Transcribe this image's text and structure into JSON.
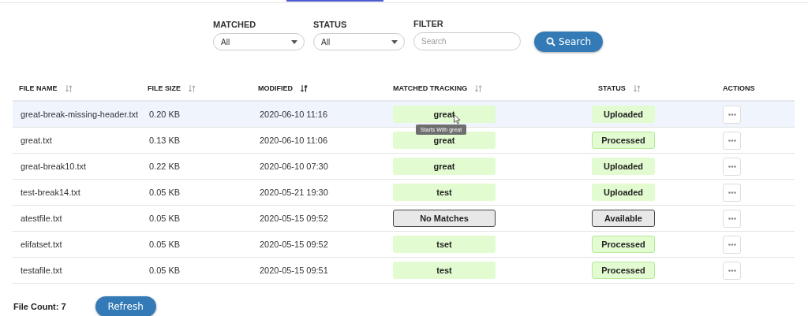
{
  "filters": [
    {
      "kind": "select",
      "label": "MATCHED",
      "value": "All"
    },
    {
      "kind": "select",
      "label": "STATUS",
      "value": "All"
    },
    {
      "kind": "text",
      "label": "FILTER",
      "placeholder": "Search"
    }
  ],
  "search_button": "Search",
  "table": {
    "columns": [
      {
        "label": "FILE NAME",
        "sortable": true,
        "sorted": false
      },
      {
        "label": "FILE SIZE",
        "sortable": true,
        "sorted": false
      },
      {
        "label": "MODIFIED",
        "sortable": true,
        "sorted": true
      },
      {
        "label": "MATCHED TRACKING",
        "sortable": true,
        "sorted": false
      },
      {
        "label": "STATUS",
        "sortable": true,
        "sorted": false
      },
      {
        "label": "ACTIONS"
      }
    ],
    "rows": [
      {
        "name": "great-break-missing-header.txt",
        "size": "0.20 KB",
        "modified": "2020-06-10 11:16",
        "match": {
          "kind": "matched",
          "text": "great"
        },
        "status": {
          "kind": "uploaded",
          "text": "Uploaded"
        },
        "highlighted": true,
        "tooltip": "Starts With great"
      },
      {
        "name": "great.txt",
        "size": "0.13 KB",
        "modified": "2020-06-10 11:06",
        "match": {
          "kind": "matched",
          "text": "great"
        },
        "status": {
          "kind": "processed",
          "text": "Processed"
        },
        "highlighted": false
      },
      {
        "name": "great-break10.txt",
        "size": "0.22 KB",
        "modified": "2020-06-10 07:30",
        "match": {
          "kind": "matched",
          "text": "great"
        },
        "status": {
          "kind": "uploaded",
          "text": "Uploaded"
        },
        "highlighted": false
      },
      {
        "name": "test-break14.txt",
        "size": "0.05 KB",
        "modified": "2020-05-21 19:30",
        "match": {
          "kind": "matched",
          "text": "test"
        },
        "status": {
          "kind": "uploaded",
          "text": "Uploaded"
        },
        "highlighted": false
      },
      {
        "name": "atestfile.txt",
        "size": "0.05 KB",
        "modified": "2020-05-15 09:52",
        "match": {
          "kind": "none",
          "text": "No Matches"
        },
        "status": {
          "kind": "available",
          "text": "Available"
        },
        "highlighted": false
      },
      {
        "name": "elifatset.txt",
        "size": "0.05 KB",
        "modified": "2020-05-15 09:52",
        "match": {
          "kind": "matched",
          "text": "tset"
        },
        "status": {
          "kind": "processed",
          "text": "Processed"
        },
        "highlighted": false
      },
      {
        "name": "testafile.txt",
        "size": "0.05 KB",
        "modified": "2020-05-15 09:51",
        "match": {
          "kind": "matched",
          "text": "test"
        },
        "status": {
          "kind": "processed",
          "text": "Processed"
        },
        "highlighted": false
      }
    ]
  },
  "footer": {
    "count": "File Count: 7",
    "refresh_button": "Refresh"
  }
}
